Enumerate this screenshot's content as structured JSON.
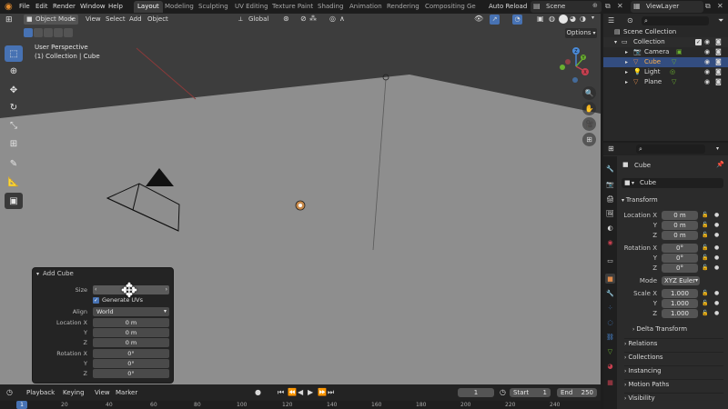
{
  "menu": {
    "items": [
      "File",
      "Edit",
      "Render",
      "Window",
      "Help"
    ]
  },
  "workspaces": [
    "Layout",
    "Modeling",
    "Sculpting",
    "UV Editing",
    "Texture Paint",
    "Shading",
    "Animation",
    "Rendering",
    "Compositing",
    "Ge"
  ],
  "topright": {
    "auto_reload": "Auto Reload",
    "scene": "Scene",
    "view_layer": "ViewLayer"
  },
  "viewport_header": {
    "mode": "Object Mode",
    "view": "View",
    "select": "Select",
    "add": "Add",
    "object": "Object",
    "orientation": "Global",
    "options": "Options"
  },
  "viewport_info": {
    "line1": "User Perspective",
    "line2": "(1) Collection | Cube"
  },
  "gizmo": {
    "x": "X",
    "y": "Y",
    "z": "Z"
  },
  "outliner": {
    "root": "Scene Collection",
    "collection": "Collection",
    "items": [
      {
        "name": "Camera",
        "type": "camera"
      },
      {
        "name": "Cube",
        "type": "mesh"
      },
      {
        "name": "Light",
        "type": "light"
      },
      {
        "name": "Plane",
        "type": "mesh"
      }
    ]
  },
  "properties": {
    "object_name": "Cube",
    "data_name": "Cube",
    "transform_label": "Transform",
    "location": {
      "label": "Location X",
      "y": "Y",
      "z": "Z",
      "vx": "0 m",
      "vy": "0 m",
      "vz": "0 m"
    },
    "rotation": {
      "label": "Rotation X",
      "y": "Y",
      "z": "Z",
      "vx": "0°",
      "vy": "0°",
      "vz": "0°"
    },
    "mode": {
      "label": "Mode",
      "value": "XYZ Euler"
    },
    "scale": {
      "label": "Scale X",
      "y": "Y",
      "z": "Z",
      "vx": "1.000",
      "vy": "1.000",
      "vz": "1.000"
    },
    "sections": [
      "Delta Transform",
      "Relations",
      "Collections",
      "Instancing",
      "Motion Paths",
      "Visibility"
    ]
  },
  "operator": {
    "title": "Add Cube",
    "size_label": "Size",
    "generate_uvs": "Generate UVs",
    "align_label": "Align",
    "align_value": "World",
    "location_label": "Location X",
    "y": "Y",
    "z": "Z",
    "loc_x": "0 m",
    "loc_y": "0 m",
    "loc_z": "0 m",
    "rotation_label": "Rotation X",
    "rot_x": "0°",
    "rot_y": "0°",
    "rot_z": "0°"
  },
  "timeline": {
    "playback": "Playback",
    "keying": "Keying",
    "view": "View",
    "marker": "Marker",
    "current_frame": "1",
    "start_label": "Start",
    "start": "1",
    "end_label": "End",
    "end": "250",
    "ticks": [
      "1",
      "20",
      "40",
      "60",
      "80",
      "100",
      "120",
      "140",
      "160",
      "180",
      "200",
      "220",
      "240"
    ]
  },
  "colors": {
    "accent": "#4772b3",
    "viewport_bg": "#3d3d3d",
    "plane": "#8e8e8e"
  }
}
